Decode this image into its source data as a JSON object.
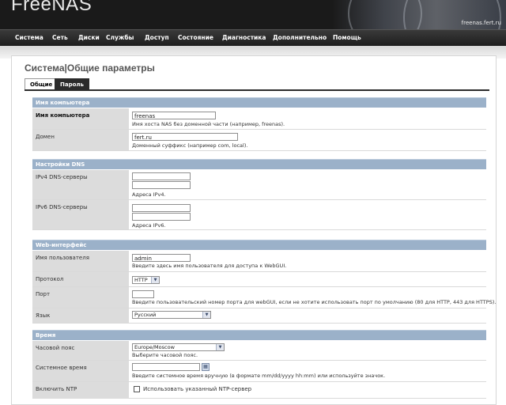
{
  "header": {
    "logo": "FreeNAS",
    "hostname": "freenas.fert.ru"
  },
  "nav": [
    "Система",
    "Сеть",
    "Диски",
    "Службы",
    "Доступ",
    "Состояние",
    "Диагностика",
    "Дополнительно",
    "Помощь"
  ],
  "page": {
    "title": "Система|Общие параметры"
  },
  "tabs": {
    "general": "Общие",
    "password": "Пароль"
  },
  "sections": {
    "hostname": "Имя компьютера",
    "dns": "Настройки DNS",
    "web": "Web-интерфейс",
    "time": "Время"
  },
  "fields": {
    "hostname": {
      "label": "Имя компьютера",
      "value": "freenas",
      "hint": "Имя хоста NAS без доменной части (например, freenas)."
    },
    "domain": {
      "label": "Домен",
      "value": "fert.ru",
      "hint": "Доменный суффикс (например com, local)."
    },
    "ipv4dns": {
      "label": "IPv4 DNS-серверы",
      "value1": "",
      "value2": "",
      "hint": "Адреса IPv4."
    },
    "ipv6dns": {
      "label": "IPv6 DNS-серверы",
      "value1": "",
      "value2": "",
      "hint": "Адреса IPv6."
    },
    "username": {
      "label": "Имя пользователя",
      "value": "admin",
      "hint": "Введите здесь имя пользователя для доступа к WebGUI."
    },
    "protocol": {
      "label": "Протокол",
      "value": "HTTP"
    },
    "port": {
      "label": "Порт",
      "value": "",
      "hint": "Введите пользовательский номер порта для webGUI, если не хотите использовать порт по умолчанию (80 для HTTP, 443 для HTTPS)."
    },
    "language": {
      "label": "Язык",
      "value": "Русский"
    },
    "timezone": {
      "label": "Часовой пояс",
      "value": "Europe/Moscow",
      "hint": "Выберите часовой пояс."
    },
    "systime": {
      "label": "Системное время",
      "value": "",
      "hint": "Введите системное время вручную (в формате mm/dd/yyyy hh:mm) или используйте значок."
    },
    "ntp": {
      "label": "Включить NTP",
      "checkbox_label": "Использовать указанный NTP-сервер",
      "checked": false
    }
  }
}
